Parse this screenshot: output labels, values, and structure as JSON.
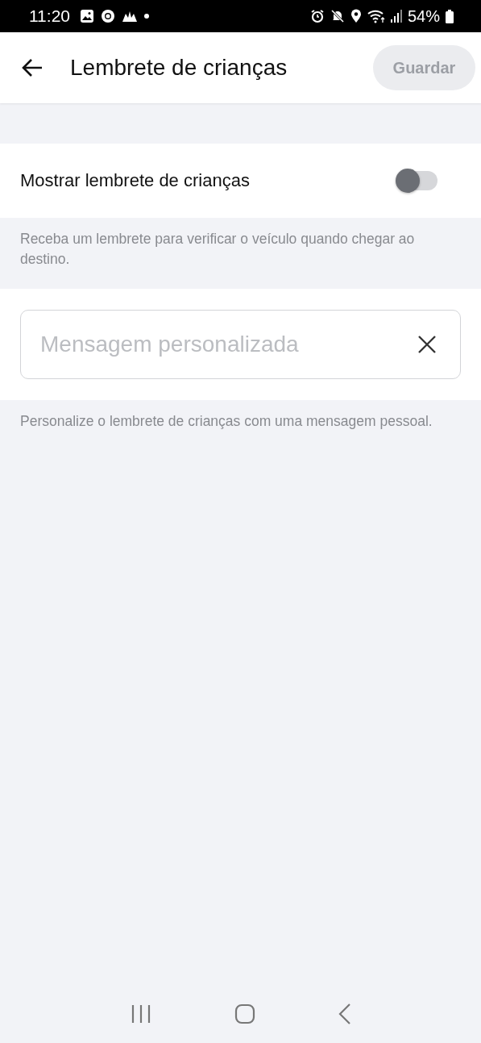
{
  "status_bar": {
    "time": "11:20",
    "battery": "54%"
  },
  "header": {
    "title": "Lembrete de crianças",
    "save_button": {
      "label": "Guardar",
      "disabled": true
    }
  },
  "reminder_toggle": {
    "label": "Mostrar lembrete de crianças",
    "on": false
  },
  "reminder_description": "Receba um lembrete para verificar o veículo quando chegar ao destino.",
  "custom_message": {
    "placeholder": "Mensagem personalizada"
  },
  "custom_message_hint": "Personalize o lembrete de crianças com uma mensagem pessoal."
}
